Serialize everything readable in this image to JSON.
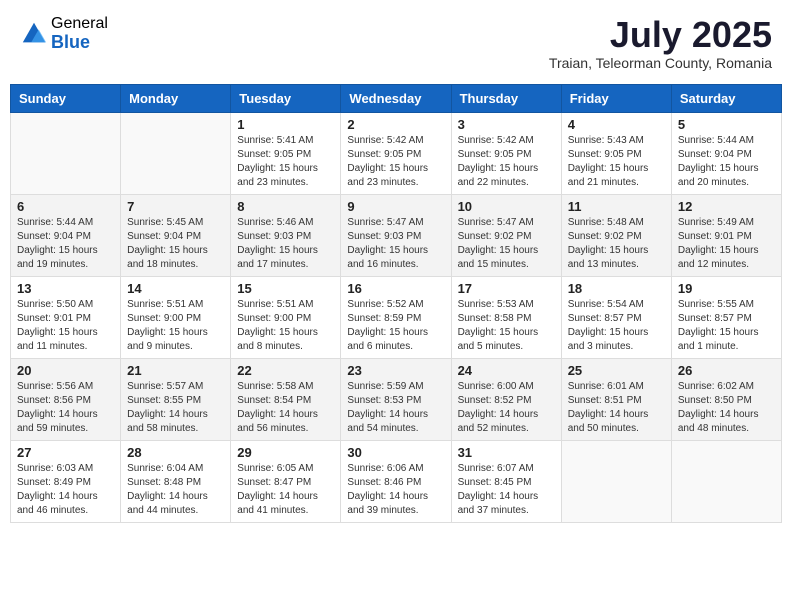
{
  "logo": {
    "general": "General",
    "blue": "Blue"
  },
  "title": {
    "month_year": "July 2025",
    "location": "Traian, Teleorman County, Romania"
  },
  "days_of_week": [
    "Sunday",
    "Monday",
    "Tuesday",
    "Wednesday",
    "Thursday",
    "Friday",
    "Saturday"
  ],
  "weeks": [
    [
      {
        "day": "",
        "info": ""
      },
      {
        "day": "",
        "info": ""
      },
      {
        "day": "1",
        "info": "Sunrise: 5:41 AM\nSunset: 9:05 PM\nDaylight: 15 hours\nand 23 minutes."
      },
      {
        "day": "2",
        "info": "Sunrise: 5:42 AM\nSunset: 9:05 PM\nDaylight: 15 hours\nand 23 minutes."
      },
      {
        "day": "3",
        "info": "Sunrise: 5:42 AM\nSunset: 9:05 PM\nDaylight: 15 hours\nand 22 minutes."
      },
      {
        "day": "4",
        "info": "Sunrise: 5:43 AM\nSunset: 9:05 PM\nDaylight: 15 hours\nand 21 minutes."
      },
      {
        "day": "5",
        "info": "Sunrise: 5:44 AM\nSunset: 9:04 PM\nDaylight: 15 hours\nand 20 minutes."
      }
    ],
    [
      {
        "day": "6",
        "info": "Sunrise: 5:44 AM\nSunset: 9:04 PM\nDaylight: 15 hours\nand 19 minutes."
      },
      {
        "day": "7",
        "info": "Sunrise: 5:45 AM\nSunset: 9:04 PM\nDaylight: 15 hours\nand 18 minutes."
      },
      {
        "day": "8",
        "info": "Sunrise: 5:46 AM\nSunset: 9:03 PM\nDaylight: 15 hours\nand 17 minutes."
      },
      {
        "day": "9",
        "info": "Sunrise: 5:47 AM\nSunset: 9:03 PM\nDaylight: 15 hours\nand 16 minutes."
      },
      {
        "day": "10",
        "info": "Sunrise: 5:47 AM\nSunset: 9:02 PM\nDaylight: 15 hours\nand 15 minutes."
      },
      {
        "day": "11",
        "info": "Sunrise: 5:48 AM\nSunset: 9:02 PM\nDaylight: 15 hours\nand 13 minutes."
      },
      {
        "day": "12",
        "info": "Sunrise: 5:49 AM\nSunset: 9:01 PM\nDaylight: 15 hours\nand 12 minutes."
      }
    ],
    [
      {
        "day": "13",
        "info": "Sunrise: 5:50 AM\nSunset: 9:01 PM\nDaylight: 15 hours\nand 11 minutes."
      },
      {
        "day": "14",
        "info": "Sunrise: 5:51 AM\nSunset: 9:00 PM\nDaylight: 15 hours\nand 9 minutes."
      },
      {
        "day": "15",
        "info": "Sunrise: 5:51 AM\nSunset: 9:00 PM\nDaylight: 15 hours\nand 8 minutes."
      },
      {
        "day": "16",
        "info": "Sunrise: 5:52 AM\nSunset: 8:59 PM\nDaylight: 15 hours\nand 6 minutes."
      },
      {
        "day": "17",
        "info": "Sunrise: 5:53 AM\nSunset: 8:58 PM\nDaylight: 15 hours\nand 5 minutes."
      },
      {
        "day": "18",
        "info": "Sunrise: 5:54 AM\nSunset: 8:57 PM\nDaylight: 15 hours\nand 3 minutes."
      },
      {
        "day": "19",
        "info": "Sunrise: 5:55 AM\nSunset: 8:57 PM\nDaylight: 15 hours\nand 1 minute."
      }
    ],
    [
      {
        "day": "20",
        "info": "Sunrise: 5:56 AM\nSunset: 8:56 PM\nDaylight: 14 hours\nand 59 minutes."
      },
      {
        "day": "21",
        "info": "Sunrise: 5:57 AM\nSunset: 8:55 PM\nDaylight: 14 hours\nand 58 minutes."
      },
      {
        "day": "22",
        "info": "Sunrise: 5:58 AM\nSunset: 8:54 PM\nDaylight: 14 hours\nand 56 minutes."
      },
      {
        "day": "23",
        "info": "Sunrise: 5:59 AM\nSunset: 8:53 PM\nDaylight: 14 hours\nand 54 minutes."
      },
      {
        "day": "24",
        "info": "Sunrise: 6:00 AM\nSunset: 8:52 PM\nDaylight: 14 hours\nand 52 minutes."
      },
      {
        "day": "25",
        "info": "Sunrise: 6:01 AM\nSunset: 8:51 PM\nDaylight: 14 hours\nand 50 minutes."
      },
      {
        "day": "26",
        "info": "Sunrise: 6:02 AM\nSunset: 8:50 PM\nDaylight: 14 hours\nand 48 minutes."
      }
    ],
    [
      {
        "day": "27",
        "info": "Sunrise: 6:03 AM\nSunset: 8:49 PM\nDaylight: 14 hours\nand 46 minutes."
      },
      {
        "day": "28",
        "info": "Sunrise: 6:04 AM\nSunset: 8:48 PM\nDaylight: 14 hours\nand 44 minutes."
      },
      {
        "day": "29",
        "info": "Sunrise: 6:05 AM\nSunset: 8:47 PM\nDaylight: 14 hours\nand 41 minutes."
      },
      {
        "day": "30",
        "info": "Sunrise: 6:06 AM\nSunset: 8:46 PM\nDaylight: 14 hours\nand 39 minutes."
      },
      {
        "day": "31",
        "info": "Sunrise: 6:07 AM\nSunset: 8:45 PM\nDaylight: 14 hours\nand 37 minutes."
      },
      {
        "day": "",
        "info": ""
      },
      {
        "day": "",
        "info": ""
      }
    ]
  ]
}
